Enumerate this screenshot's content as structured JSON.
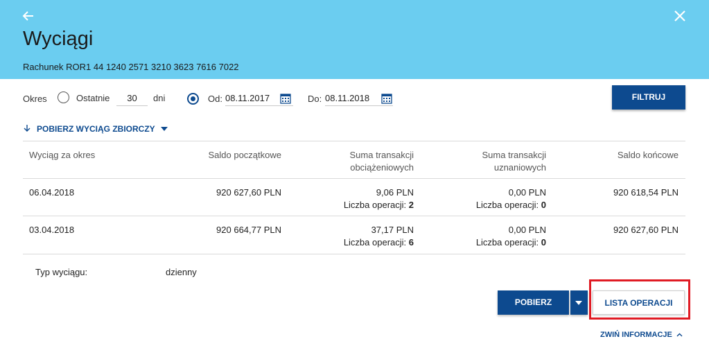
{
  "header": {
    "title": "Wyciągi",
    "account": "Rachunek ROR1 44 1240 2571 3210 3623 7616 7022",
    "back_icon": "arrow-left-icon",
    "close_icon": "close-icon"
  },
  "filter": {
    "period_label": "Okres",
    "last_label": "Ostatnie",
    "last_value": "30",
    "days_label": "dni",
    "from_label": "Od:",
    "from_value": "08.11.2017",
    "to_label": "Do:",
    "to_value": "08.11.2018",
    "filter_button": "FILTRUJ",
    "selected_option": "date-range"
  },
  "download_summary": "POBIERZ WYCIĄG ZBIORCZY",
  "table": {
    "headers": {
      "period": "Wyciąg za okres",
      "opening": "Saldo początkowe",
      "debit_line1": "Suma transakcji",
      "debit_line2": "obciążeniowych",
      "credit_line1": "Suma transakcji",
      "credit_line2": "uznaniowych",
      "closing": "Saldo końcowe"
    },
    "ops_label": "Liczba operacji:",
    "rows": [
      {
        "date": "06.04.2018",
        "opening": "920 627,60  PLN",
        "debit": "9,06  PLN",
        "debit_ops": "2",
        "credit": "0,00  PLN",
        "credit_ops": "0",
        "closing": "920 618,54  PLN"
      },
      {
        "date": "03.04.2018",
        "opening": "920 664,77  PLN",
        "debit": "37,17  PLN",
        "debit_ops": "6",
        "credit": "0,00  PLN",
        "credit_ops": "0",
        "closing": "920 627,60  PLN"
      }
    ]
  },
  "statement_type_label": "Typ wyciągu:",
  "statement_type_value": "dzienny",
  "actions": {
    "download": "POBIERZ",
    "operations_list": "LISTA OPERACJI",
    "collapse": "ZWIŃ INFORMACJE"
  },
  "colors": {
    "header_bg": "#6bcdf0",
    "primary": "#0d4a8f",
    "highlight": "#e01b24"
  }
}
